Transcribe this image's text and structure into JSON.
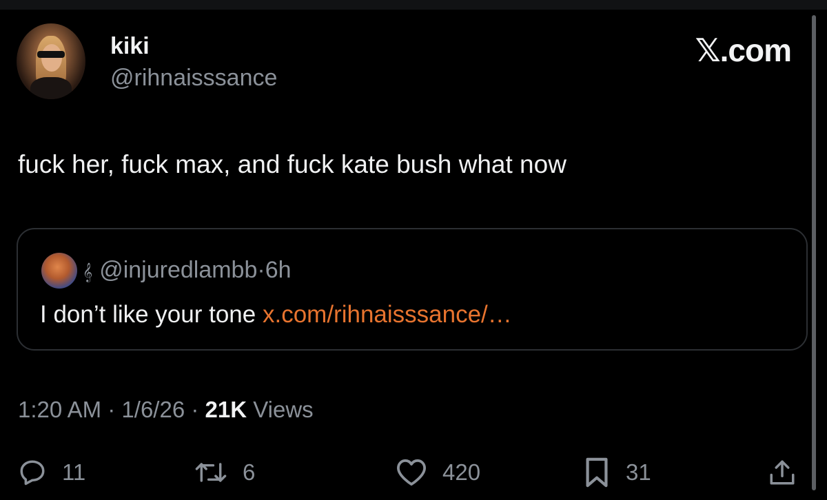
{
  "author": {
    "name": "kiki",
    "handle": "@rihnaisssance"
  },
  "brand": "𝕏.com",
  "tweet": {
    "text": "fuck her, fuck max, and fuck kate bush what now"
  },
  "quote": {
    "clef_icon": "𝄞",
    "handle": "@injuredlambb",
    "separator": "·",
    "time": "6h",
    "text": "I don’t like your tone",
    "link": "x.com/rihnaisssance/…"
  },
  "meta": {
    "time": "1:20 AM",
    "date": "1/6/26",
    "views_count": "21K",
    "views_label": "Views",
    "separator": "·"
  },
  "actions": {
    "replies": "11",
    "reposts": "6",
    "likes": "420",
    "bookmarks": "31"
  },
  "colors": {
    "background": "#000000",
    "link": "#e8742f",
    "secondary_text": "#8b9199"
  }
}
